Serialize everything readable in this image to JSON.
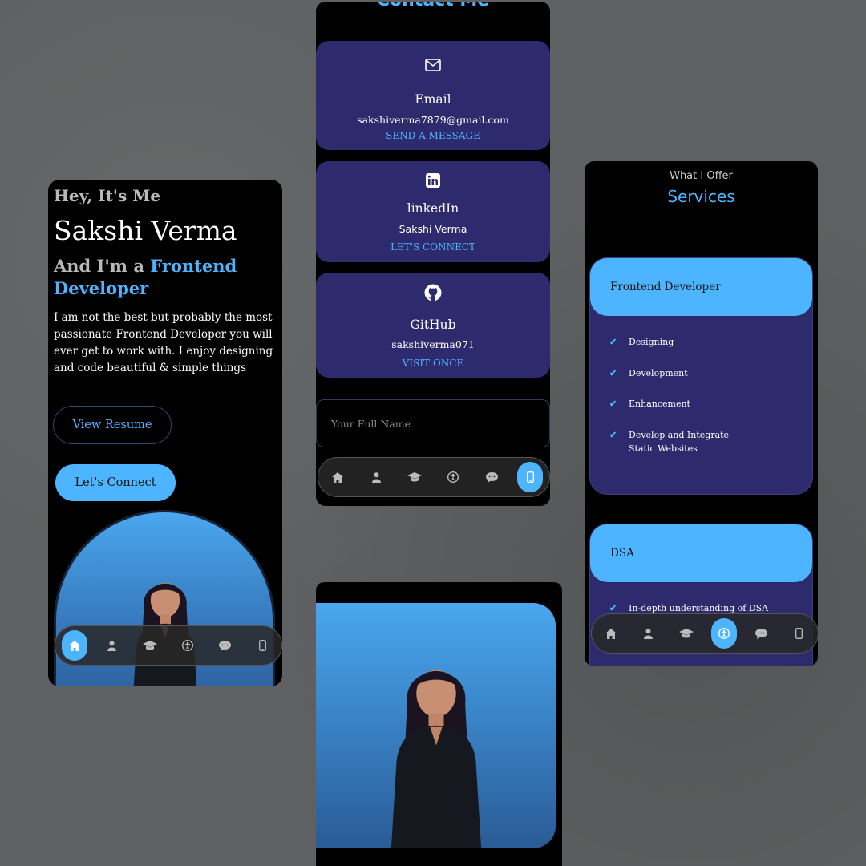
{
  "hero": {
    "greeting": "Hey, It's Me",
    "name": "Sakshi Verma",
    "role_prefix": "And I'm a ",
    "role_highlight": "Frontend Developer",
    "description": "I am not the best but probably the most passionate Frontend Developer you will ever get to work with. I enjoy designing and code beautiful & simple things",
    "view_resume": "View Resume",
    "lets_connect": "Let's Connect"
  },
  "nav_icons": [
    "home-icon",
    "user-icon",
    "graduation-cap-icon",
    "accessibility-icon",
    "chat-icon",
    "mobile-icon"
  ],
  "contact": {
    "title": "Contact Me",
    "cards": [
      {
        "icon": "envelope-icon",
        "title": "Email",
        "value": "sakshiverma7879@gmail.com",
        "link": "SEND A MESSAGE"
      },
      {
        "icon": "linkedin-icon",
        "title": "linkedIn",
        "value": "Sakshi Verma",
        "link": "LET'S CONNECT"
      },
      {
        "icon": "github-icon",
        "title": "GitHub",
        "value": "sakshiverma071",
        "link": "VISIT ONCE"
      }
    ],
    "name_placeholder": "Your Full Name"
  },
  "services": {
    "subtitle": "What I Offer",
    "title": "Services",
    "items": [
      {
        "name": "Frontend Developer",
        "features": [
          "Designing",
          "Development",
          "Enhancement",
          "Develop and Integrate Static Websites"
        ]
      },
      {
        "name": "DSA",
        "features": [
          "In-depth understanding of DSA"
        ]
      }
    ]
  },
  "colors": {
    "accent": "#4db5ff",
    "card": "#2d2b6e",
    "bg": "#000000"
  }
}
